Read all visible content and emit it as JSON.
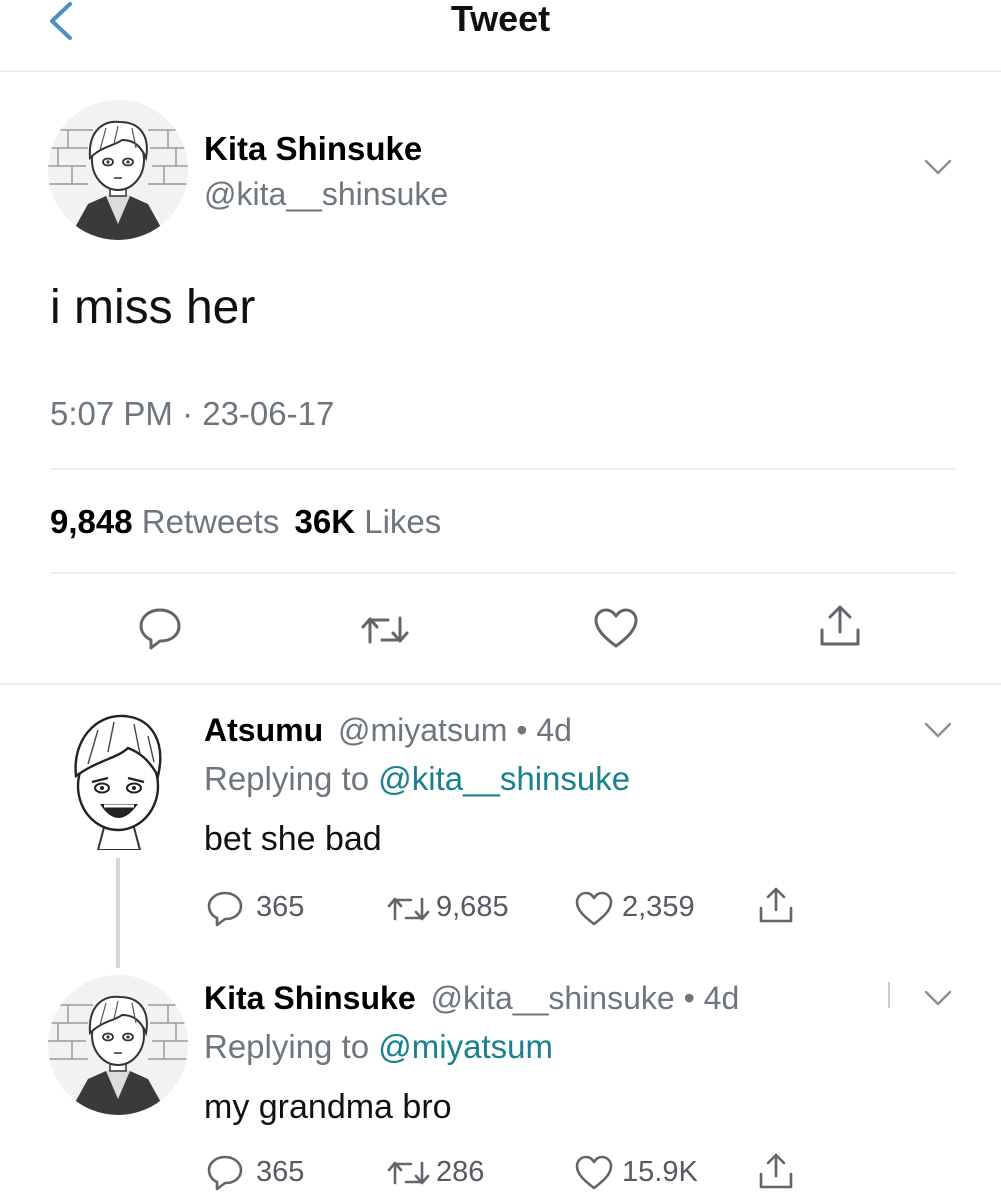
{
  "header": {
    "title": "Tweet"
  },
  "main_tweet": {
    "display_name": "Kita Shinsuke",
    "handle": "@kita__shinsuke",
    "text": "i miss her",
    "timestamp": "5:07 PM · 23-06-17",
    "retweets_count": "9,848",
    "retweets_label": "Retweets",
    "likes_count": "36K",
    "likes_label": "Likes"
  },
  "replies": [
    {
      "display_name": "Atsumu",
      "handle": "@miyatsum",
      "time": "• 4d",
      "replying_prefix": "Replying to",
      "replying_to": "@kita__shinsuke",
      "text": "bet she bad",
      "reply_count": "365",
      "retweet_count": "9,685",
      "like_count": "2,359"
    },
    {
      "display_name": "Kita Shinsuke",
      "handle": "@kita__shinsuke",
      "time": "• 4d",
      "replying_prefix": "Replying to",
      "replying_to": "@miyatsum",
      "text": "my grandma bro",
      "reply_count": "365",
      "retweet_count": "286",
      "like_count": "15.9K"
    }
  ],
  "colors": {
    "link": "#19818e",
    "muted": "#6e767d",
    "divider": "#eceef0",
    "back_chevron": "#4a90c8"
  },
  "icons": [
    "back-chevron-icon",
    "chevron-down-icon",
    "reply-icon",
    "retweet-icon",
    "like-icon",
    "share-icon"
  ]
}
